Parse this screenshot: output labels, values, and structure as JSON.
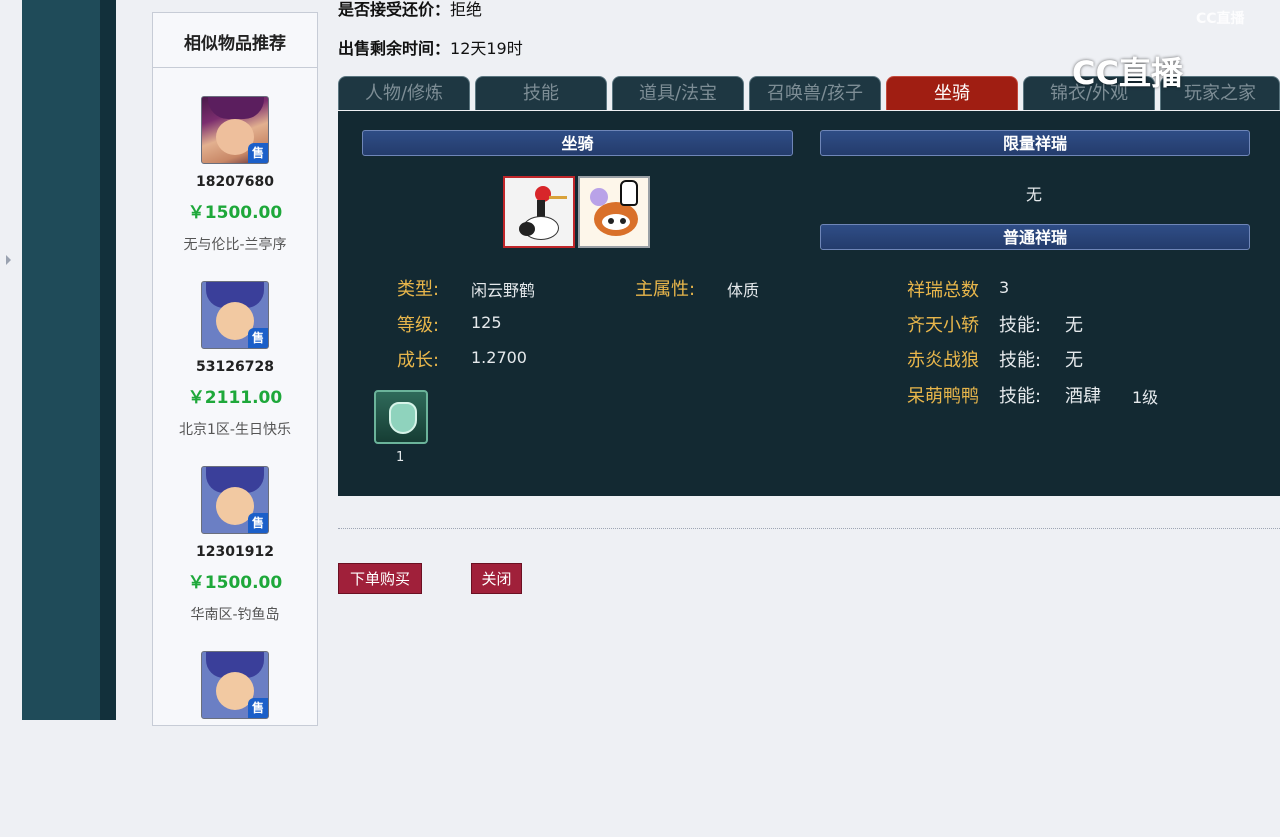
{
  "trade_info": {
    "bargain_label": "是否接受还价：",
    "bargain_value": "拒绝",
    "remaining_label": "出售剩余时间：",
    "remaining_value": "12天19时"
  },
  "sidebar": {
    "title": "相似物品推荐",
    "sale_badge": "售",
    "items": [
      {
        "id": "18207680",
        "price": "￥1500.00",
        "server": "无与伦比-兰亭序"
      },
      {
        "id": "53126728",
        "price": "￥2111.00",
        "server": "北京1区-生日快乐"
      },
      {
        "id": "12301912",
        "price": "￥1500.00",
        "server": "华南区-钓鱼岛"
      },
      {
        "id": "",
        "price": "",
        "server": ""
      }
    ]
  },
  "tabs": [
    "人物/修炼",
    "技能",
    "道具/法宝",
    "召唤兽/孩子",
    "坐骑",
    "锦衣/外观",
    "玩家之家"
  ],
  "active_tab": "坐骑",
  "mount": {
    "section_title": "坐骑",
    "type_label": "类型:",
    "type_value": "闲云野鹤",
    "attr_label": "主属性:",
    "attr_value": "体质",
    "level_label": "等级:",
    "level_value": "125",
    "growth_label": "成长:",
    "growth_value": "1.2700",
    "item_count": "1"
  },
  "auspicious": {
    "limited_title": "限量祥瑞",
    "limited_value": "无",
    "normal_title": "普通祥瑞",
    "total_label": "祥瑞总数",
    "total_value": "3",
    "list": [
      {
        "name": "齐天小轿",
        "skill_label": "技能:",
        "skill": "无",
        "level": ""
      },
      {
        "name": "赤炎战狼",
        "skill_label": "技能:",
        "skill": "无",
        "level": ""
      },
      {
        "name": "呆萌鸭鸭",
        "skill_label": "技能:",
        "skill": "酒肆",
        "level": "1级"
      }
    ]
  },
  "actions": {
    "buy": "下单购买",
    "close": "关闭"
  },
  "watermark": {
    "small": "CC直播",
    "large": "CC直播"
  }
}
